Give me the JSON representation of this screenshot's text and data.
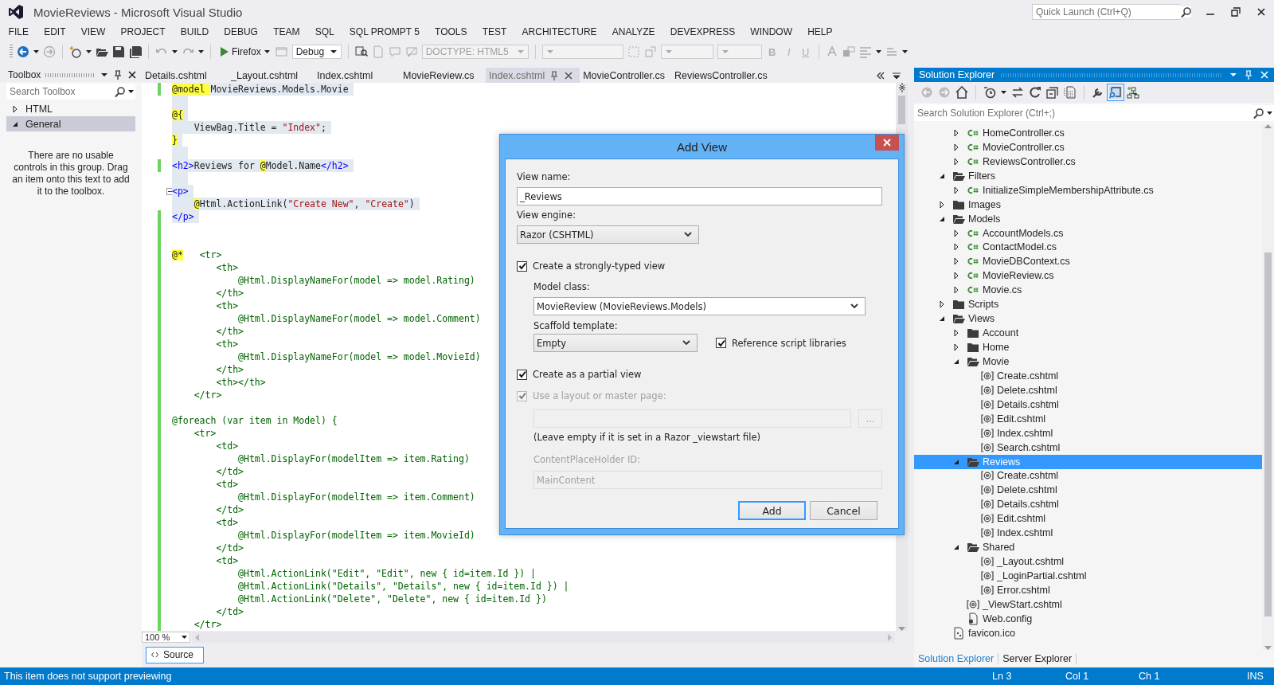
{
  "window": {
    "title": "MovieReviews - Microsoft Visual Studio",
    "quick_launch": {
      "placeholder": "Quick Launch (Ctrl+Q)"
    }
  },
  "menu": [
    "FILE",
    "EDIT",
    "VIEW",
    "PROJECT",
    "BUILD",
    "DEBUG",
    "TEAM",
    "SQL",
    "SQL PROMPT 5",
    "TOOLS",
    "TEST",
    "ARCHITECTURE",
    "ANALYZE",
    "DEVEXPRESS",
    "WINDOW",
    "HELP"
  ],
  "toolbar": {
    "run_target": "Firefox",
    "configuration": "Debug",
    "doctype": {
      "text": "DOCTYPE: HTML5",
      "disabled": true
    },
    "format_buttons": [
      {
        "label": "B",
        "disabled": true
      },
      {
        "label": "I",
        "disabled": true
      },
      {
        "label": "U",
        "disabled": true
      }
    ]
  },
  "toolbox": {
    "title": "Toolbox",
    "search": {
      "placeholder": "Search Toolbox"
    },
    "groups": [
      {
        "label": "HTML",
        "expanded": false,
        "selected": false
      },
      {
        "label": "General",
        "expanded": true,
        "selected": true
      }
    ],
    "message": "There are no usable controls in this group. Drag an item onto this text to add it to the toolbox."
  },
  "editor": {
    "tabs": [
      {
        "label": "Details.cshtml",
        "selected": false
      },
      {
        "label": "_Layout.cshtml",
        "selected": false
      },
      {
        "label": "Index.cshtml",
        "selected": false
      },
      {
        "label": "MovieReview.cs",
        "selected": false
      },
      {
        "label": "Index.cshtml",
        "selected": true
      },
      {
        "label": "MovieController.cs",
        "selected": false
      },
      {
        "label": "ReviewsController.cs",
        "selected": false
      }
    ],
    "lines": [
      {
        "kind": "code",
        "text": "@model MovieReviews.Models.Movie",
        "changed": true,
        "selected": true,
        "fold": false
      },
      {
        "kind": "blank",
        "changed": false,
        "selected": true,
        "fold": false
      },
      {
        "kind": "code",
        "text": "@{",
        "changed": false,
        "selected": true,
        "fold": false
      },
      {
        "kind": "code",
        "text": "    ViewBag.Title = \"Index\";",
        "changed": false,
        "selected": true,
        "fold": false
      },
      {
        "kind": "code",
        "text": "}",
        "changed": false,
        "selected": true,
        "fold": false
      },
      {
        "kind": "blank",
        "changed": false,
        "selected": true,
        "fold": false
      },
      {
        "kind": "code",
        "text": "<h2>Reviews for @Model.Name</h2>",
        "changed": true,
        "selected": true,
        "fold": false
      },
      {
        "kind": "blank",
        "changed": false,
        "selected": true,
        "fold": false
      },
      {
        "kind": "code",
        "text": "<p>",
        "changed": false,
        "selected": true,
        "fold": true
      },
      {
        "kind": "code",
        "text": "    @Html.ActionLink(\"Create New\", \"Create\")",
        "changed": false,
        "selected": true,
        "fold": false
      },
      {
        "kind": "code",
        "text": "</p>",
        "changed": true,
        "selected": true,
        "fold": false
      },
      {
        "kind": "blank",
        "changed": true,
        "selected": false,
        "fold": false
      },
      {
        "kind": "blank",
        "changed": true,
        "selected": false,
        "fold": false
      },
      {
        "kind": "comment",
        "text": "@*   <tr>",
        "changed": true,
        "selected": false,
        "fold": false
      },
      {
        "kind": "comment",
        "text": "        <th>",
        "changed": true,
        "selected": false,
        "fold": false
      },
      {
        "kind": "comment",
        "text": "            @Html.DisplayNameFor(model => model.Rating)",
        "changed": true,
        "selected": false,
        "fold": false
      },
      {
        "kind": "comment",
        "text": "        </th>",
        "changed": true,
        "selected": false,
        "fold": false
      },
      {
        "kind": "comment",
        "text": "        <th>",
        "changed": true,
        "selected": false,
        "fold": false
      },
      {
        "kind": "comment",
        "text": "            @Html.DisplayNameFor(model => model.Comment)",
        "changed": true,
        "selected": false,
        "fold": false
      },
      {
        "kind": "comment",
        "text": "        </th>",
        "changed": true,
        "selected": false,
        "fold": false
      },
      {
        "kind": "comment",
        "text": "        <th>",
        "changed": true,
        "selected": false,
        "fold": false
      },
      {
        "kind": "comment",
        "text": "            @Html.DisplayNameFor(model => model.MovieId)",
        "changed": true,
        "selected": false,
        "fold": false
      },
      {
        "kind": "comment",
        "text": "        </th>",
        "changed": true,
        "selected": false,
        "fold": false
      },
      {
        "kind": "comment",
        "text": "        <th></th>",
        "changed": true,
        "selected": false,
        "fold": false
      },
      {
        "kind": "comment",
        "text": "    </tr>",
        "changed": true,
        "selected": false,
        "fold": false
      },
      {
        "kind": "blank",
        "changed": true,
        "selected": false,
        "fold": false
      },
      {
        "kind": "comment",
        "text": "@foreach (var item in Model) {",
        "changed": true,
        "selected": false,
        "fold": false
      },
      {
        "kind": "comment",
        "text": "    <tr>",
        "changed": true,
        "selected": false,
        "fold": false
      },
      {
        "kind": "comment",
        "text": "        <td>",
        "changed": true,
        "selected": false,
        "fold": false
      },
      {
        "kind": "comment",
        "text": "            @Html.DisplayFor(modelItem => item.Rating)",
        "changed": true,
        "selected": false,
        "fold": false
      },
      {
        "kind": "comment",
        "text": "        </td>",
        "changed": true,
        "selected": false,
        "fold": false
      },
      {
        "kind": "comment",
        "text": "        <td>",
        "changed": true,
        "selected": false,
        "fold": false
      },
      {
        "kind": "comment",
        "text": "            @Html.DisplayFor(modelItem => item.Comment)",
        "changed": true,
        "selected": false,
        "fold": false
      },
      {
        "kind": "comment",
        "text": "        </td>",
        "changed": true,
        "selected": false,
        "fold": false
      },
      {
        "kind": "comment",
        "text": "        <td>",
        "changed": true,
        "selected": false,
        "fold": false
      },
      {
        "kind": "comment",
        "text": "            @Html.DisplayFor(modelItem => item.MovieId)",
        "changed": true,
        "selected": false,
        "fold": false
      },
      {
        "kind": "comment",
        "text": "        </td>",
        "changed": true,
        "selected": false,
        "fold": false
      },
      {
        "kind": "comment",
        "text": "        <td>",
        "changed": true,
        "selected": false,
        "fold": false
      },
      {
        "kind": "comment",
        "text": "            @Html.ActionLink(\"Edit\", \"Edit\", new { id=item.Id }) |",
        "changed": true,
        "selected": false,
        "fold": false
      },
      {
        "kind": "comment",
        "text": "            @Html.ActionLink(\"Details\", \"Details\", new { id=item.Id }) |",
        "changed": true,
        "selected": false,
        "fold": false
      },
      {
        "kind": "comment",
        "text": "            @Html.ActionLink(\"Delete\", \"Delete\", new { id=item.Id })",
        "changed": true,
        "selected": false,
        "fold": false
      },
      {
        "kind": "comment",
        "text": "        </td>",
        "changed": true,
        "selected": false,
        "fold": false
      },
      {
        "kind": "comment",
        "text": "    </tr>",
        "changed": true,
        "selected": false,
        "fold": false
      }
    ],
    "zoom": "100 %",
    "view_tab": "Source"
  },
  "solution_explorer": {
    "title": "Solution Explorer",
    "search": {
      "placeholder": "Search Solution Explorer (Ctrl+;)"
    },
    "tree": [
      {
        "children": [
          {
            "label": "HomeController.cs",
            "kind": "cs",
            "expanded": false,
            "selected": false
          },
          {
            "label": "MovieController.cs",
            "kind": "cs",
            "expanded": false,
            "selected": false
          },
          {
            "label": "ReviewsController.cs",
            "kind": "cs",
            "expanded": false,
            "selected": false
          }
        ]
      },
      {
        "label": "Filters",
        "kind": "folder",
        "expanded": true,
        "selected": false,
        "children": [
          {
            "label": "InitializeSimpleMembershipAttribute.cs",
            "kind": "cs",
            "expanded": false,
            "selected": false
          }
        ]
      },
      {
        "label": "Images",
        "kind": "folder",
        "expanded": false,
        "selected": false
      },
      {
        "label": "Models",
        "kind": "folder",
        "expanded": true,
        "selected": false,
        "children": [
          {
            "label": "AccountModels.cs",
            "kind": "cs",
            "expanded": false,
            "selected": false
          },
          {
            "label": "ContactModel.cs",
            "kind": "cs",
            "expanded": false,
            "selected": false
          },
          {
            "label": "MovieDBContext.cs",
            "kind": "cs",
            "expanded": false,
            "selected": false
          },
          {
            "label": "MovieReview.cs",
            "kind": "cs",
            "expanded": false,
            "selected": false
          },
          {
            "label": "Movie.cs",
            "kind": "cs",
            "expanded": false,
            "selected": false
          }
        ]
      },
      {
        "label": "Scripts",
        "kind": "folder",
        "expanded": false,
        "selected": false
      },
      {
        "label": "Views",
        "kind": "folder",
        "expanded": true,
        "selected": false,
        "children": [
          {
            "label": "Account",
            "kind": "folder",
            "expanded": false,
            "selected": false
          },
          {
            "label": "Home",
            "kind": "folder",
            "expanded": false,
            "selected": false
          },
          {
            "label": "Movie",
            "kind": "folder",
            "expanded": true,
            "selected": false,
            "children": [
              {
                "label": "Create.cshtml",
                "kind": "cshtml",
                "selected": false
              },
              {
                "label": "Delete.cshtml",
                "kind": "cshtml",
                "selected": false
              },
              {
                "label": "Details.cshtml",
                "kind": "cshtml",
                "selected": false
              },
              {
                "label": "Edit.cshtml",
                "kind": "cshtml",
                "selected": false
              },
              {
                "label": "Index.cshtml",
                "kind": "cshtml",
                "selected": false
              },
              {
                "label": "Search.cshtml",
                "kind": "cshtml",
                "selected": false
              }
            ]
          },
          {
            "label": "Reviews",
            "kind": "folder",
            "expanded": true,
            "selected": true,
            "children": [
              {
                "label": "Create.cshtml",
                "kind": "cshtml",
                "selected": false
              },
              {
                "label": "Delete.cshtml",
                "kind": "cshtml",
                "selected": false
              },
              {
                "label": "Details.cshtml",
                "kind": "cshtml",
                "selected": false
              },
              {
                "label": "Edit.cshtml",
                "kind": "cshtml",
                "selected": false
              },
              {
                "label": "Index.cshtml",
                "kind": "cshtml",
                "selected": false
              }
            ]
          },
          {
            "label": "Shared",
            "kind": "folder",
            "expanded": true,
            "selected": false,
            "children": [
              {
                "label": "_Layout.cshtml",
                "kind": "cshtml",
                "selected": false
              },
              {
                "label": "_LoginPartial.cshtml",
                "kind": "cshtml",
                "selected": false
              },
              {
                "label": "Error.cshtml",
                "kind": "cshtml",
                "selected": false
              }
            ]
          },
          {
            "label": "_ViewStart.cshtml",
            "kind": "cshtml",
            "selected": false
          },
          {
            "label": "Web.config",
            "kind": "config",
            "selected": false
          }
        ]
      },
      {
        "label": "favicon.ico",
        "kind": "file",
        "selected": false
      }
    ],
    "bottom_tabs": [
      {
        "label": "Solution Explorer",
        "selected": true
      },
      {
        "label": "Server Explorer",
        "selected": false
      }
    ]
  },
  "dialog": {
    "title": "Add View",
    "view_name": {
      "label": "View name:",
      "value": "_Reviews"
    },
    "view_engine": {
      "label": "View engine:",
      "value": "Razor (CSHTML)"
    },
    "strongly_typed": {
      "label": "Create a strongly-typed view",
      "checked": true
    },
    "model_class": {
      "label": "Model class:",
      "value": "MovieReview (MovieReviews.Models)"
    },
    "scaffold_template": {
      "label": "Scaffold template:",
      "value": "Empty"
    },
    "reference_scripts": {
      "label": "Reference script libraries",
      "checked": true
    },
    "partial_view": {
      "label": "Create as a partial view",
      "checked": true
    },
    "use_layout": {
      "label": "Use a layout or master page:",
      "checked": true,
      "disabled": true
    },
    "layout_path": {
      "disabled": true
    },
    "browse_button": {
      "label": "...",
      "disabled": true
    },
    "layout_hint": "(Leave empty if it is set in a Razor _viewstart file)",
    "placeholder_id": {
      "label": "ContentPlaceHolder ID:",
      "value": "MainContent",
      "disabled": true
    },
    "buttons": [
      {
        "label": "Add",
        "default": true
      },
      {
        "label": "Cancel",
        "default": false
      }
    ]
  },
  "status_bar": {
    "message": "This item does not support previewing",
    "line": "Ln 3",
    "column": "Col 1",
    "char": "Ch 1",
    "mode": "INS"
  }
}
